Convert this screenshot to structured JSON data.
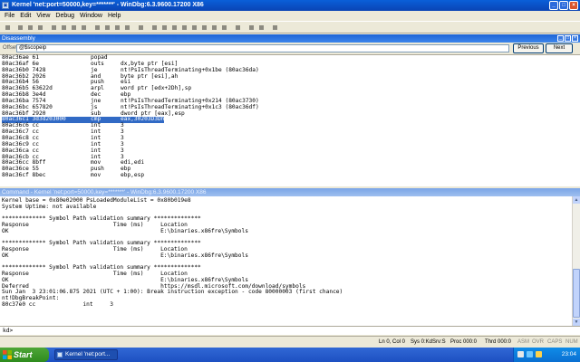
{
  "window": {
    "title": "Kernel 'net:port=50000,key=*******' - WinDbg:6.3.9600.17200 X86"
  },
  "menubar": [
    "File",
    "Edit",
    "View",
    "Debug",
    "Window",
    "Help"
  ],
  "disassembly": {
    "title": "Disassembly",
    "offset_label": "Offset:",
    "offset_value": "@$scopeip",
    "previous_label": "Previous",
    "next_label": "Next",
    "rows": [
      {
        "addr": "80ac36ae 61",
        "op": "popad",
        "args": ""
      },
      {
        "addr": "80ac36af 6e",
        "op": "outs",
        "args": "dx,byte ptr [esi]"
      },
      {
        "addr": "80ac36b0 7428",
        "op": "je",
        "args": "nt!PsIsThreadTerminating+0x1be (80ac36da)"
      },
      {
        "addr": "80ac36b2 2026",
        "op": "and",
        "args": "byte ptr [esi],ah"
      },
      {
        "addr": "80ac36b4 56",
        "op": "push",
        "args": "esi"
      },
      {
        "addr": "80ac36b5 63622d",
        "op": "arpl",
        "args": "word ptr [edx+2Dh],sp"
      },
      {
        "addr": "80ac36b8 3e4d",
        "op": "dec",
        "args": "ebp"
      },
      {
        "addr": "80ac36ba 7574",
        "op": "jne",
        "args": "nt!PsIsThreadTerminating+0x214 (80ac3730)"
      },
      {
        "addr": "80ac36bc 657820",
        "op": "js",
        "args": "nt!PsIsThreadTerminating+0x1c3 (80ac36df)"
      },
      {
        "addr": "80ac36bf 2920",
        "op": "sub",
        "args": "dword ptr [eax],esp"
      },
      {
        "addr": "80ac36c1 3d3d203000",
        "op": "cmp",
        "args": "eax,30203D3Dh"
      },
      {
        "addr": "80ac36c6 cc",
        "op": "int",
        "args": "3"
      },
      {
        "addr": "80ac36c7 cc",
        "op": "int",
        "args": "3"
      },
      {
        "addr": "80ac36c8 cc",
        "op": "int",
        "args": "3"
      },
      {
        "addr": "80ac36c9 cc",
        "op": "int",
        "args": "3"
      },
      {
        "addr": "80ac36ca cc",
        "op": "int",
        "args": "3"
      },
      {
        "addr": "80ac36cb cc",
        "op": "int",
        "args": "3"
      },
      {
        "addr": "80ac36cc 8bff",
        "op": "mov",
        "args": "edi,edi"
      },
      {
        "addr": "80ac36ce 55",
        "op": "push",
        "args": "ebp"
      },
      {
        "addr": "80ac36cf 8bec",
        "op": "mov",
        "args": "ebp,esp"
      }
    ],
    "highlighted_row_index": 10
  },
  "command": {
    "title": "Command - Kernel 'net:port=50000,key=*******' - WinDbg:6.3.9600.17200 X86",
    "output_lines": [
      "Kernel base = 0x80e02000 PsLoadedModuleList = 0x80b019e8",
      "System Uptime: not available",
      "",
      "************* Symbol Path validation summary **************",
      "Response                         Time (ms)     Location",
      "OK                                             E:\\binaries.x86fre\\Symbols",
      "",
      "************* Symbol Path validation summary **************",
      "Response                         Time (ms)     Location",
      "OK                                             E:\\binaries.x86fre\\Symbols",
      "",
      "************* Symbol Path validation summary **************",
      "Response                         Time (ms)     Location",
      "OK                                             E:\\binaries.x86fre\\Symbols",
      "Deferred                                       https://msdl.microsoft.com/download/symbols",
      "Sun Jan  3 23:01:06.875 2021 (UTC + 1:00): Break instruction exception - code 80000003 (first chance)",
      "nt!DbgBreakPoint:",
      "80c37e0 cc              int     3"
    ],
    "prompt": "kd>",
    "input_value": ""
  },
  "statusbar": {
    "position": "Ln 0, Col 0",
    "sys": "Sys 0:KdSrv:S",
    "proc": "Proc 000:0",
    "thrd": "Thrd 000:0",
    "asm": "ASM",
    "ovr": "OVR",
    "caps": "CAPS",
    "num": "NUM"
  },
  "taskbar": {
    "start_label": "Start",
    "task_label": "Kernel 'net:port...",
    "clock": "23:04"
  },
  "colors": {
    "titlebar": "#0a44b4",
    "highlight": "#316ac5",
    "taskbar": "#245edb",
    "start": "#3c9b2a"
  }
}
